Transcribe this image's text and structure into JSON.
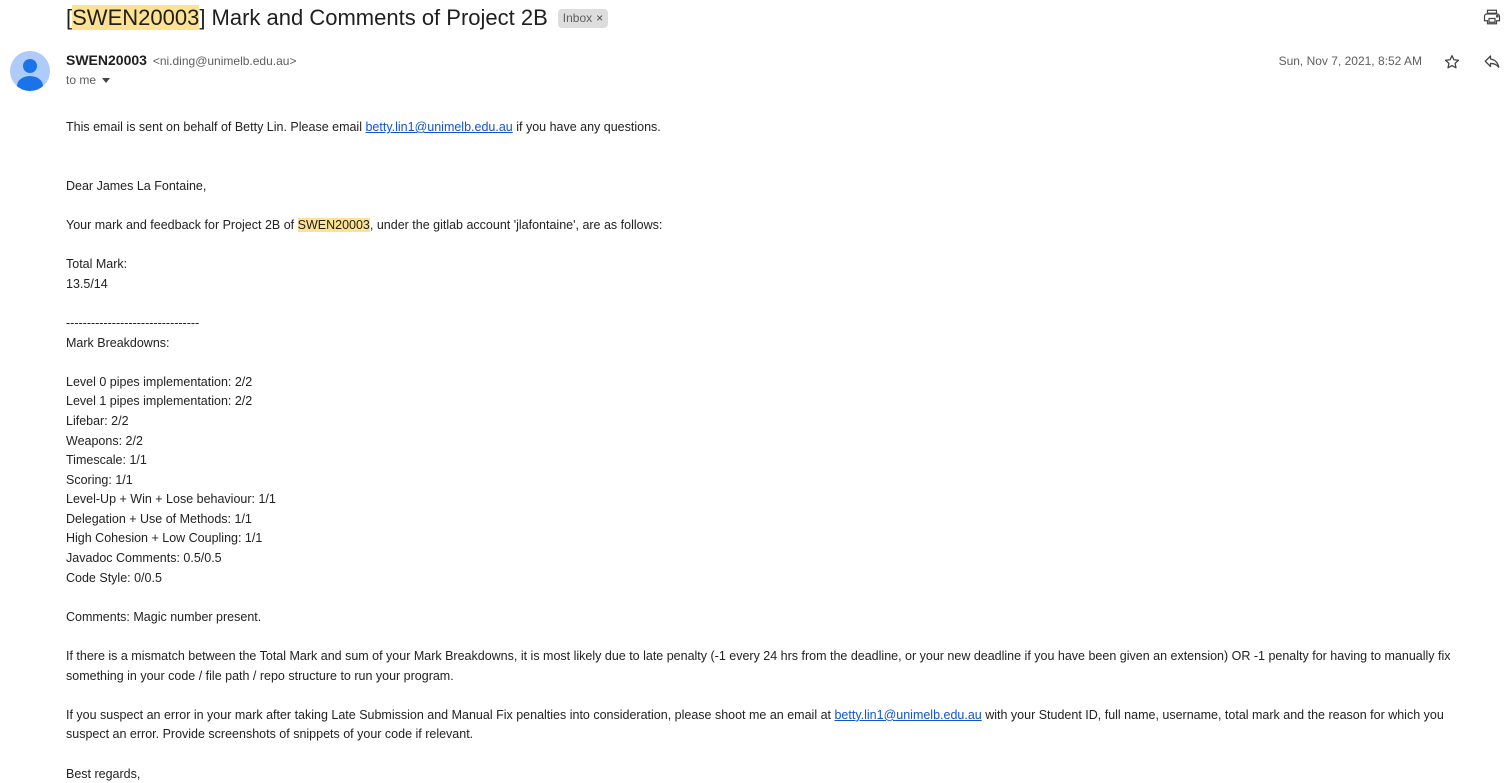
{
  "subject": {
    "prefix": "[",
    "course_code": "SWEN20003",
    "rest": "] Mark and Comments of Project 2B",
    "label_chip": "Inbox",
    "label_chip_close": "×"
  },
  "header": {
    "sender_name": "SWEN20003",
    "sender_email": "<ni.ding@unimelb.edu.au>",
    "to_text": "to me",
    "date": "Sun, Nov 7, 2021, 8:52 AM"
  },
  "icons": {
    "print": "print-icon",
    "star": "star-icon",
    "reply": "reply-icon",
    "avatar": "person-icon",
    "caret": "chevron-down-icon"
  },
  "colors": {
    "highlight": "#fde293",
    "link": "#1155cc",
    "avatar_bg": "#aecbfa",
    "avatar_fg": "#1a73e8"
  },
  "body": {
    "intro_before_link": "This email is sent on behalf of Betty Lin. Please email ",
    "intro_link": "betty.lin1@unimelb.edu.au",
    "intro_after_link": " if you have any questions.",
    "greeting": "Dear James La Fontaine,",
    "feedback_before": "Your mark and feedback for Project 2B of ",
    "feedback_code": "SWEN20003",
    "feedback_after": ", under the gitlab account 'jlafontaine', are as follows:",
    "total_label": "Total Mark:",
    "total_value": "13.5/14",
    "divider": "--------------------------------",
    "breakdown_label": "Mark Breakdowns:",
    "breakdowns": [
      "Level 0 pipes implementation: 2/2",
      "Level 1 pipes implementation: 2/2",
      "Lifebar: 2/2",
      "Weapons: 2/2",
      "Timescale: 1/1",
      "Scoring: 1/1",
      "Level-Up + Win + Lose behaviour: 1/1",
      "Delegation + Use of Methods: 1/1",
      "High Cohesion + Low Coupling: 1/1",
      "Javadoc Comments: 0.5/0.5",
      "Code Style: 0/0.5"
    ],
    "comments": "Comments: Magic number present.",
    "mismatch_line1": "If there is a mismatch between the Total Mark and sum of your Mark Breakdowns, it is most likely due to late penalty (-1 every 24 hrs from the deadline, or your new deadline if you have been given an extension) OR -1 penalty for having to manually fix",
    "mismatch_line2": "something in your code / file path / repo structure to run your program.",
    "error_before_link": "If you suspect an error in your mark after taking Late Submission and Manual Fix penalties into consideration, please shoot me an email at ",
    "error_link": "betty.lin1@unimelb.edu.au",
    "error_after_link": " with your Student ID, full name, username, total mark and the reason for which you",
    "error_line2": "suspect an error. Provide screenshots of snippets of your code if relevant.",
    "closing": "Best regards,"
  }
}
